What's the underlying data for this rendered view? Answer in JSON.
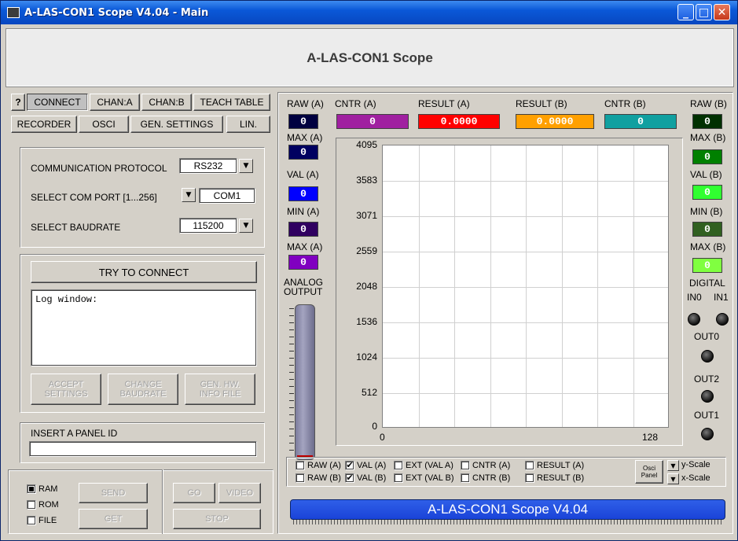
{
  "window": {
    "title": "A-LAS-CON1 Scope V4.04 - Main",
    "minimize": "_",
    "maximize": "□",
    "close": "✕"
  },
  "header": {
    "title": "A-LAS-CON1 Scope"
  },
  "tabs": {
    "help": "?",
    "connect": "CONNECT",
    "chan_a": "CHAN:A",
    "chan_b": "CHAN:B",
    "teach_table": "TEACH TABLE",
    "recorder": "RECORDER",
    "osci": "OSCI",
    "gen_settings": "GEN. SETTINGS",
    "lin": "LIN."
  },
  "connection": {
    "protocol_label": "COMMUNICATION PROTOCOL",
    "protocol_value": "RS232",
    "comport_label": "SELECT COM PORT [1...256]",
    "comport_value": "COM1",
    "baud_label": "SELECT BAUDRATE",
    "baud_value": "115200",
    "try_connect": "TRY TO CONNECT",
    "log_text": "Log window:",
    "accept": "ACCEPT SETTINGS",
    "change_baud": "CHANGE BAUDRATE",
    "gen_hw": "GEN. HW. INFO FILE",
    "panel_id_label": "INSERT A PANEL ID",
    "panel_id_value": ""
  },
  "memory": {
    "ram": "RAM",
    "rom": "ROM",
    "file": "FILE",
    "ram_checked": true,
    "send": "SEND",
    "get": "GET",
    "go": "GO",
    "video": "VIDEO",
    "stop": "STOP"
  },
  "left_indicators": {
    "raw_a": "RAW (A)",
    "raw_a_val": "0",
    "max_a": "MAX (A)",
    "max_a_val": "0",
    "val_a": "VAL (A)",
    "val_a_val": "0",
    "min_a": "MIN (A)",
    "min_a_val": "0",
    "max_a2": "MAX (A)",
    "max_a2_val": "0",
    "analog_output": "ANALOG OUTPUT"
  },
  "top_indicators": {
    "cntr_a": "CNTR (A)",
    "cntr_a_val": "0",
    "result_a": "RESULT (A)",
    "result_a_val": "0.0000",
    "result_b": "RESULT (B)",
    "result_b_val": "0.0000",
    "cntr_b": "CNTR (B)",
    "cntr_b_val": "0"
  },
  "right_indicators": {
    "raw_b": "RAW (B)",
    "raw_b_val": "0",
    "max_b": "MAX (B)",
    "max_b_val": "0",
    "val_b": "VAL (B)",
    "val_b_val": "0",
    "min_b": "MIN (B)",
    "min_b_val": "0",
    "max_b2": "MAX (B)",
    "max_b2_val": "0",
    "digital": "DIGITAL",
    "in0": "IN0",
    "in1": "IN1",
    "out0": "OUT0",
    "out2": "OUT2",
    "out1": "OUT1"
  },
  "colors": {
    "raw_a": "#000040",
    "cntr_a": "#a020a0",
    "result_a": "#ff0000",
    "result_b": "#ffa000",
    "cntr_b": "#10a0a0",
    "max_a": "#000060",
    "val_a": "#0000ff",
    "min_a": "#300060",
    "max_a2": "#8000c0",
    "raw_b": "#003000",
    "max_b": "#008000",
    "val_b": "#30ff30",
    "min_b": "#306020",
    "max_b2": "#80ff40"
  },
  "chart": {
    "y_ticks": [
      "4095",
      "3583",
      "3071",
      "2559",
      "2048",
      "1536",
      "1024",
      "512",
      "0"
    ],
    "x_min": "0",
    "x_max": "128"
  },
  "checkboxes": {
    "row1": [
      {
        "label": "RAW (A)",
        "checked": false
      },
      {
        "label": "VAL (A)",
        "checked": true
      },
      {
        "label": "EXT (VAL A)",
        "checked": false
      },
      {
        "label": "CNTR (A)",
        "checked": false
      },
      {
        "label": "RESULT (A)",
        "checked": false
      }
    ],
    "row2": [
      {
        "label": "RAW (B)",
        "checked": false
      },
      {
        "label": "VAL (B)",
        "checked": true
      },
      {
        "label": "EXT (VAL B)",
        "checked": false
      },
      {
        "label": "CNTR (B)",
        "checked": false
      },
      {
        "label": "RESULT (B)",
        "checked": false
      }
    ],
    "osci_panel": "Osci Panel",
    "y_scale": "y-Scale",
    "x_scale": "x-Scale"
  },
  "status": {
    "text": "A-LAS-CON1 Scope V4.04"
  }
}
